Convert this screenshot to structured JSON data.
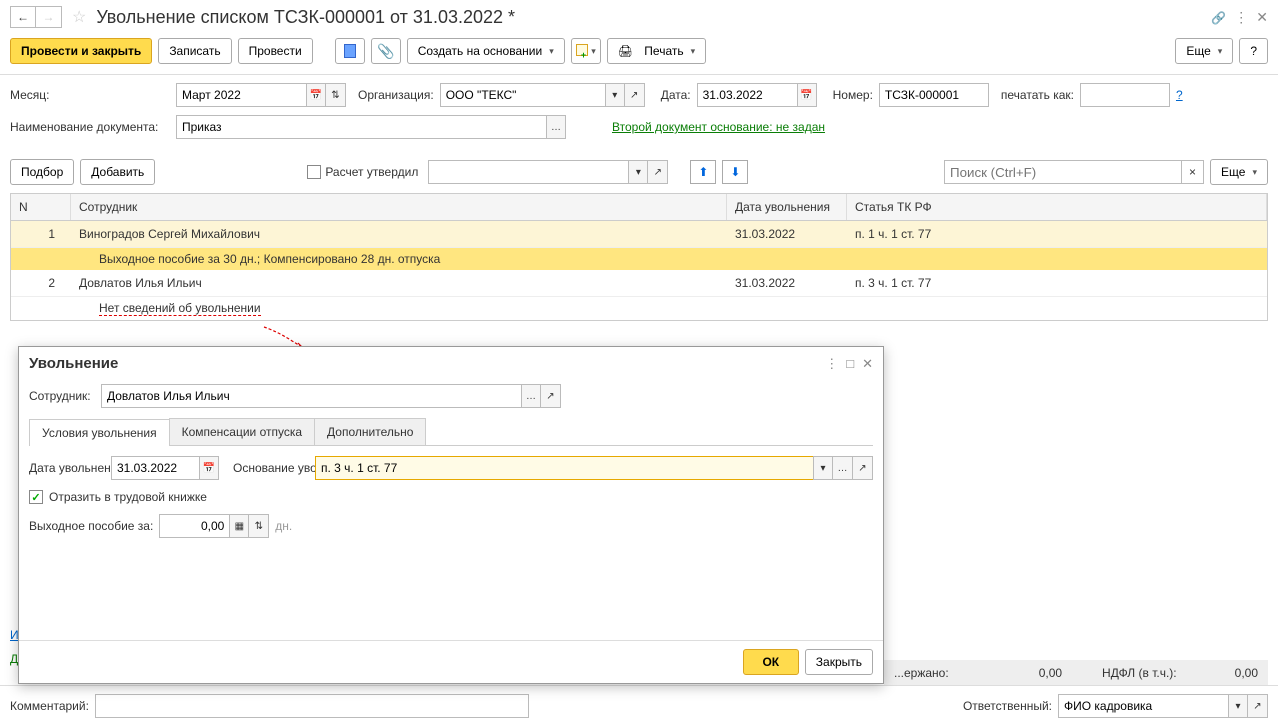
{
  "window": {
    "title": "Увольнение списком ТСЗК-000001 от 31.03.2022 *"
  },
  "toolbar": {
    "post_close": "Провести и закрыть",
    "save": "Записать",
    "post": "Провести",
    "create_basis": "Создать на основании",
    "print": "Печать",
    "more": "Еще",
    "help": "?"
  },
  "header": {
    "month_label": "Месяц:",
    "month_value": "Март 2022",
    "org_label": "Организация:",
    "org_value": "ООО \"ТЕКС\"",
    "date_label": "Дата:",
    "date_value": "31.03.2022",
    "number_label": "Номер:",
    "number_value": "ТСЗК-000001",
    "print_as_label": "печатать как:",
    "print_as_value": "",
    "doc_name_label": "Наименование документа:",
    "doc_name_value": "Приказ",
    "second_basis_link": "Второй документ основание: не задан"
  },
  "sub": {
    "select_btn": "Подбор",
    "add_btn": "Добавить",
    "calc_approved_label": "Расчет утвердил",
    "calc_approved_value": "",
    "search_placeholder": "Поиск (Ctrl+F)",
    "more": "Еще"
  },
  "table": {
    "cols": {
      "n": "N",
      "emp": "Сотрудник",
      "date": "Дата увольнения",
      "article": "Статья ТК РФ"
    },
    "rows": [
      {
        "n": "1",
        "emp": "Виноградов Сергей Михайлович",
        "date": "31.03.2022",
        "article": "п. 1 ч. 1 ст. 77",
        "detail": "Выходное пособие за 30 дн.; Компенсировано 28 дн. отпуска",
        "selected": true
      },
      {
        "n": "2",
        "emp": "Довлатов Илья Ильич",
        "date": "31.03.2022",
        "article": "п. 3 ч. 1 ст. 77",
        "detail_err": "Нет сведений об увольнении"
      }
    ]
  },
  "totals": {
    "withheld_label": "...ержано:",
    "withheld_value": "0,00",
    "ndfl_label": "НДФЛ (в т.ч.):",
    "ndfl_value": "0,00"
  },
  "side_links": {
    "a": "И",
    "b": "Д"
  },
  "footer": {
    "comment_label": "Комментарий:",
    "comment_value": "",
    "responsible_label": "Ответственный:",
    "responsible_value": "ФИО кадровика"
  },
  "dialog": {
    "title": "Увольнение",
    "emp_label": "Сотрудник:",
    "emp_value": "Довлатов Илья Ильич",
    "tabs": {
      "t1": "Условия увольнения",
      "t2": "Компенсации отпуска",
      "t3": "Дополнительно"
    },
    "date_label": "Дата увольнения:",
    "date_value": "31.03.2022",
    "basis_label": "Основание увольнения:",
    "basis_value": "п. 3 ч. 1 ст. 77",
    "reflect_label": "Отразить в трудовой книжке",
    "severance_label": "Выходное пособие за:",
    "severance_value": "0,00",
    "severance_unit": "дн.",
    "ok": "ОК",
    "close": "Закрыть"
  }
}
